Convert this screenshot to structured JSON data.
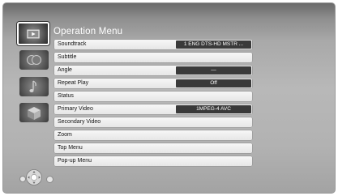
{
  "menu": {
    "title": "Operation Menu",
    "items": [
      {
        "label": "Soundtrack",
        "value": "1 ENG DTS-HD MSTR ..."
      },
      {
        "label": "Subtitle",
        "value": ""
      },
      {
        "label": "Angle",
        "value": "—"
      },
      {
        "label": "Repeat Play",
        "value": "Off"
      },
      {
        "label": "Status",
        "value": ""
      },
      {
        "label": "Primary Video",
        "value": "1MPEG-4 AVC"
      },
      {
        "label": "Secondary Video",
        "value": ""
      },
      {
        "label": "Zoom",
        "value": ""
      },
      {
        "label": "Top Menu",
        "value": ""
      },
      {
        "label": "Pop-up Menu",
        "value": ""
      }
    ]
  },
  "side_icons": [
    "disc-play-icon",
    "audio-settings-icon",
    "music-note-icon",
    "cube-icon"
  ],
  "colors": {
    "panel": "#b5b5b5",
    "value_bg": "#3a3a3a",
    "row_bg": "#f0f0f0",
    "title": "#ffffff"
  }
}
